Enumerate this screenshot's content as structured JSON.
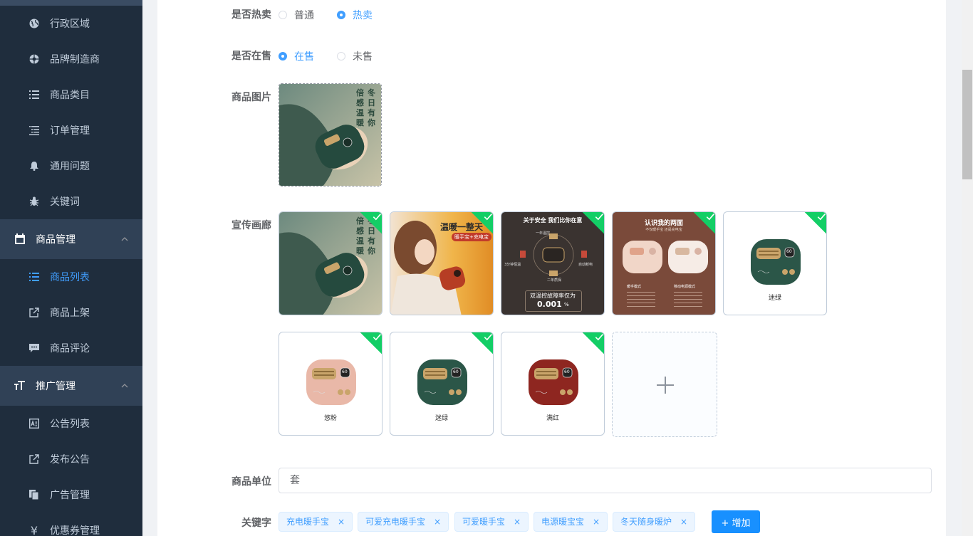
{
  "sidebar": {
    "items": [
      {
        "label": "行政区域",
        "icon": "globe-icon"
      },
      {
        "label": "品牌制造商",
        "icon": "aperture-icon"
      },
      {
        "label": "商品类目",
        "icon": "list-icon"
      },
      {
        "label": "订单管理",
        "icon": "order-list-icon"
      },
      {
        "label": "通用问题",
        "icon": "bell-icon"
      },
      {
        "label": "关键词",
        "icon": "bug-icon"
      }
    ],
    "goods_group": {
      "label": "商品管理",
      "icon": "clipboard-icon"
    },
    "goods_items": [
      {
        "label": "商品列表",
        "icon": "list-icon",
        "active": true
      },
      {
        "label": "商品上架",
        "icon": "external-link-icon"
      },
      {
        "label": "商品评论",
        "icon": "message-icon"
      }
    ],
    "promo_group": {
      "label": "推广管理",
      "icon": "font-size-icon"
    },
    "promo_items": [
      {
        "label": "公告列表",
        "icon": "notice-icon"
      },
      {
        "label": "发布公告",
        "icon": "external-link-icon"
      },
      {
        "label": "广告管理",
        "icon": "documents-icon"
      },
      {
        "label": "优惠券管理",
        "icon": "yen-icon"
      }
    ]
  },
  "form": {
    "is_hot": {
      "label": "是否热卖",
      "options": [
        "普通",
        "热卖"
      ],
      "selected": "热卖"
    },
    "on_sale": {
      "label": "是否在售",
      "options": [
        "在售",
        "未售"
      ],
      "selected": "在售"
    },
    "pic": {
      "label": "商品图片",
      "texts": [
        "倍感温暖",
        "冬日有你"
      ]
    },
    "gallery": {
      "label": "宣传画廊",
      "items": [
        {
          "kind": "hand",
          "texts": [
            "倍感温暖",
            "冬日有你"
          ]
        },
        {
          "kind": "girl",
          "title": "温暖一整天",
          "sub": "暖手宝+充电宝"
        },
        {
          "kind": "safety",
          "title": "关于安全 我们比你在意",
          "line1": "双温控故障率仅为",
          "line2": "0.001",
          "unit": "%",
          "labels": [
            "一年温控",
            "3分钟恒温",
            "自动断电",
            "二年质保"
          ]
        },
        {
          "kind": "twosides",
          "title": "认识我的两面",
          "sub": "不仅暖手宝 还是充电宝",
          "left": "暖手模式",
          "right": "移动电源模式"
        },
        {
          "kind": "product",
          "color": "#2b5648",
          "caption": "迷绿",
          "num": "60"
        },
        {
          "kind": "product",
          "color": "#e9b8a8",
          "caption": "悠粉",
          "num": "60"
        },
        {
          "kind": "product",
          "color": "#2b5648",
          "caption": "迷绿",
          "num": "60"
        },
        {
          "kind": "product",
          "color": "#8e2620",
          "caption": "满红",
          "num": "60"
        }
      ]
    },
    "unit": {
      "label": "商品单位",
      "value": "套"
    },
    "keywords": {
      "label": "关键字",
      "tags": [
        "充电暖手宝",
        "可爱充电暖手宝",
        "可爱暖手宝",
        "电源暖宝宝",
        "冬天随身暖炉"
      ],
      "add_label": "+ 增加"
    }
  },
  "colors": {
    "primary": "#409eff",
    "sidebar": "#304156",
    "success": "#13ce66"
  }
}
